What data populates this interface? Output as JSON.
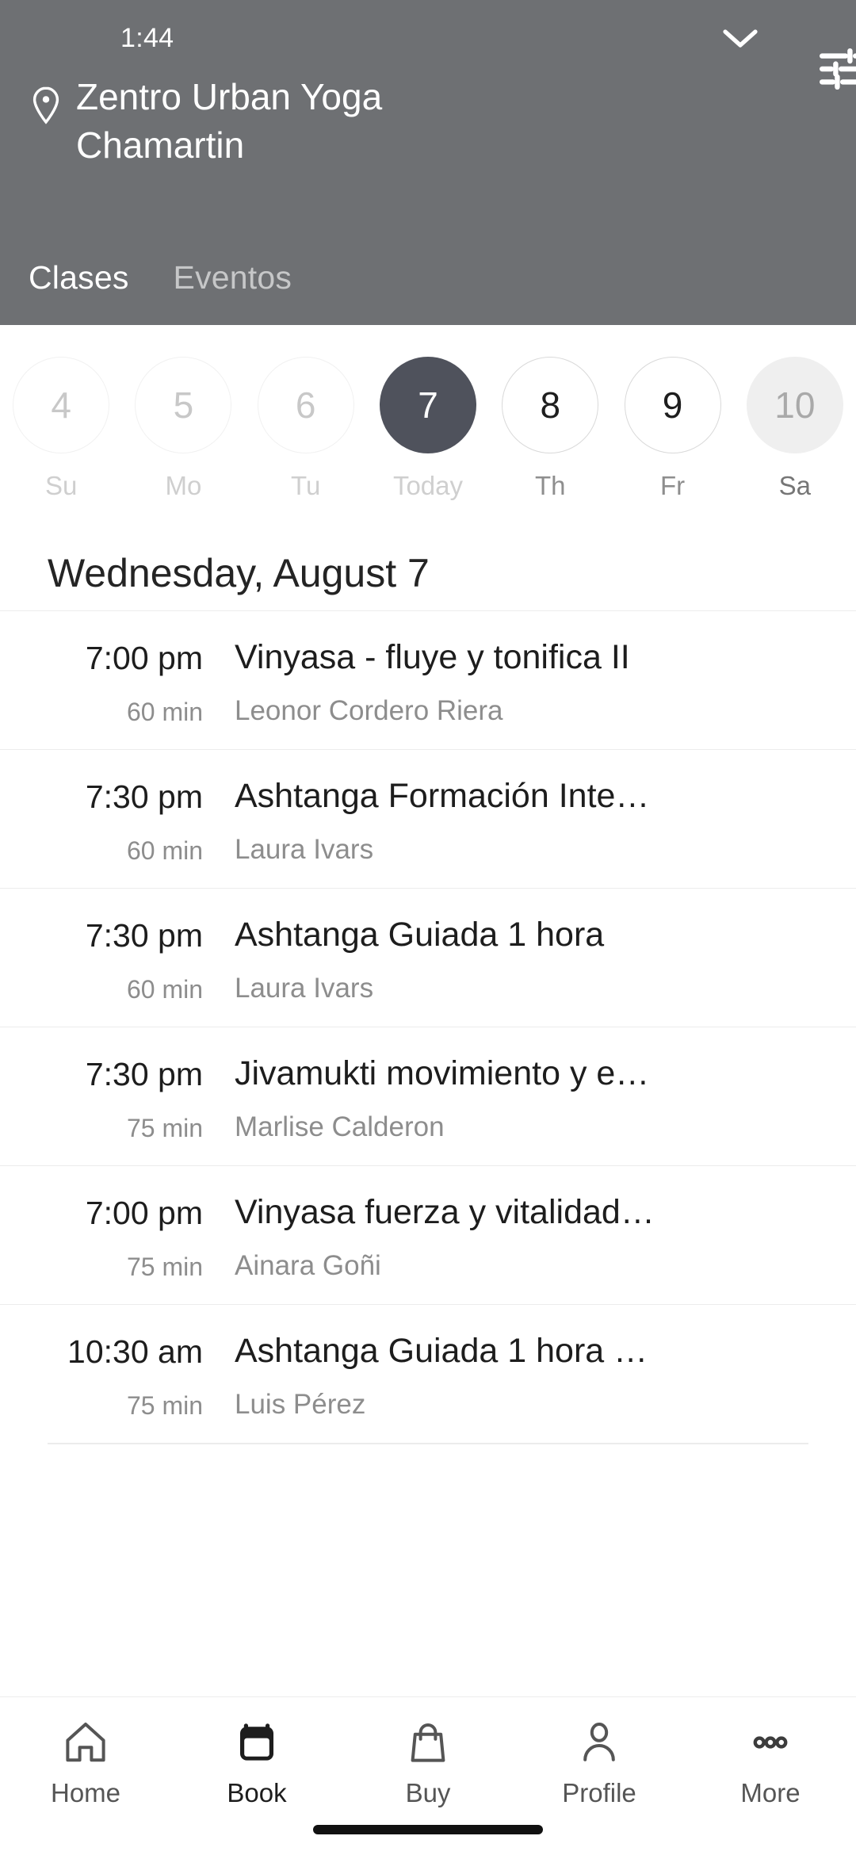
{
  "status_bar": {
    "clock": "1:44"
  },
  "header": {
    "venue_name": "Zentro Urban Yoga Chamartin",
    "location_pin_icon": "location-pin-icon",
    "chevron_icon": "chevron-down-icon",
    "filter_icon": "filter-sliders-icon",
    "background_color": "#6e7073",
    "tabs": [
      {
        "label": "Clases",
        "active": true
      },
      {
        "label": "Eventos",
        "active": false
      }
    ]
  },
  "date_strip": {
    "days": [
      {
        "number": "4",
        "weekday": "Su",
        "state": "dim"
      },
      {
        "number": "5",
        "weekday": "Mo",
        "state": "dim"
      },
      {
        "number": "6",
        "weekday": "Tu",
        "state": "dim"
      },
      {
        "number": "7",
        "weekday": "Today",
        "state": "selected"
      },
      {
        "number": "8",
        "weekday": "Th",
        "state": "normal"
      },
      {
        "number": "9",
        "weekday": "Fr",
        "state": "normal"
      },
      {
        "number": "10",
        "weekday": "Sa",
        "state": "filled"
      }
    ],
    "selected_color": "#4f525c",
    "filled_color": "#efefef"
  },
  "schedule": {
    "date_heading": "Wednesday, August 7",
    "classes": [
      {
        "time": "7:00 pm",
        "duration": "60 min",
        "name": "Vinyasa - fluye y tonifica II",
        "instructor": "Leonor Cordero Riera"
      },
      {
        "time": "7:30 pm",
        "duration": "60 min",
        "name": "Ashtanga Formación Inte…",
        "instructor": "Laura Ivars"
      },
      {
        "time": "7:30 pm",
        "duration": "60 min",
        "name": "Ashtanga Guiada 1 hora",
        "instructor": "Laura Ivars"
      },
      {
        "time": "7:30 pm",
        "duration": "75 min",
        "name": "Jivamukti movimiento y e…",
        "instructor": "Marlise Calderon"
      },
      {
        "time": "7:00 pm",
        "duration": "75 min",
        "name": "Vinyasa fuerza y vitalidad…",
        "instructor": "Ainara Goñi"
      },
      {
        "time": "10:30 am",
        "duration": "75 min",
        "name": "Ashtanga Guiada 1 hora …",
        "instructor": "Luis Pérez"
      }
    ]
  },
  "bottom_nav": {
    "items": [
      {
        "label": "Home",
        "icon": "home-icon",
        "active": false
      },
      {
        "label": "Book",
        "icon": "calendar-icon",
        "active": true
      },
      {
        "label": "Buy",
        "icon": "bag-icon",
        "active": false
      },
      {
        "label": "Profile",
        "icon": "person-icon",
        "active": false
      },
      {
        "label": "More",
        "icon": "ellipsis-icon",
        "active": false
      }
    ]
  }
}
